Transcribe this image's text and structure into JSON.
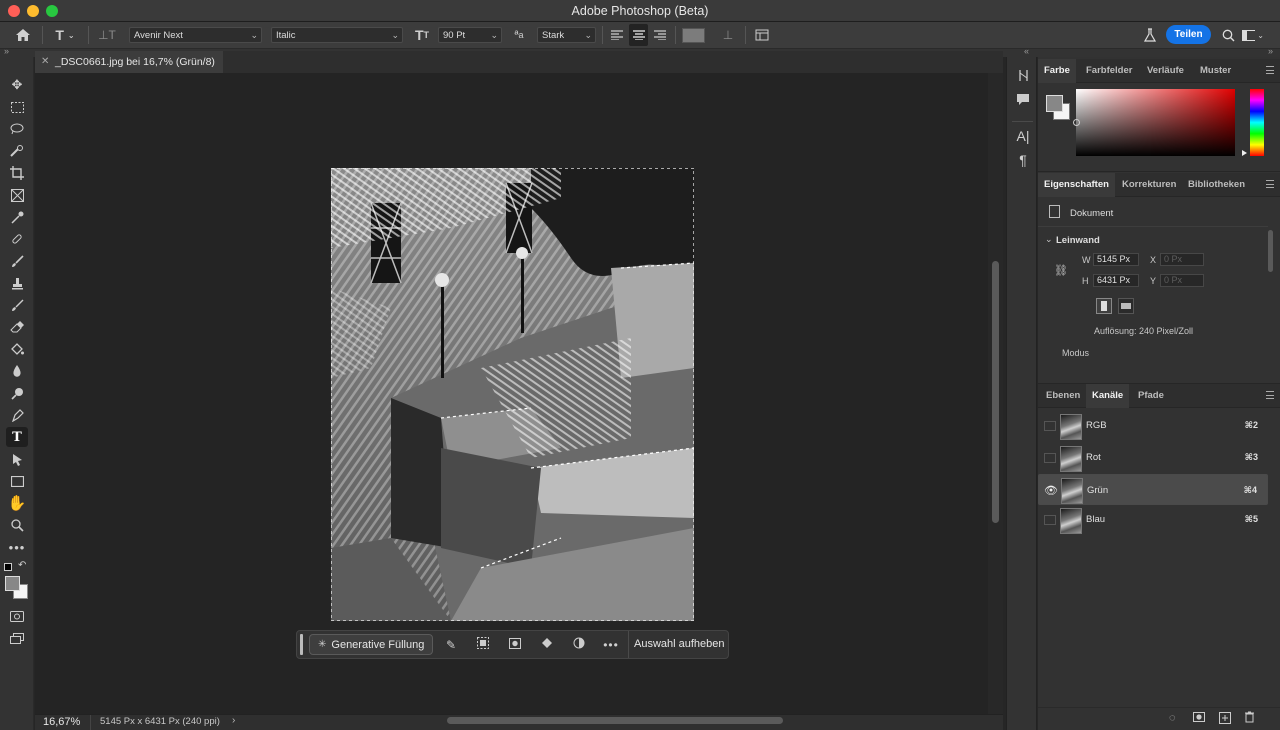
{
  "window": {
    "title": "Adobe Photoshop (Beta)"
  },
  "options_bar": {
    "font_family": "Avenir Next",
    "font_style": "Italic",
    "font_size": "90 Pt",
    "antialias": "Stark",
    "share_label": "Teilen"
  },
  "document": {
    "tab_title": "_DSC0661.jpg bei 16,7% (Grün/8)",
    "zoom": "16,67%",
    "info": "5145 Px x 6431 Px (240 ppi)"
  },
  "context_bar": {
    "generative_fill_label": "Generative Füllung",
    "deselect_label": "Auswahl aufheben"
  },
  "color_panel": {
    "tabs": [
      "Farbe",
      "Farbfelder",
      "Verläufe",
      "Muster"
    ],
    "hue_color": "#e00000"
  },
  "properties_panel": {
    "tabs": [
      "Eigenschaften",
      "Korrekturen",
      "Bibliotheken"
    ],
    "doc_label": "Dokument",
    "section": "Leinwand",
    "w_label": "W",
    "w_value": "5145 Px",
    "h_label": "H",
    "h_value": "6431 Px",
    "x_label": "X",
    "x_value": "0 Px",
    "y_label": "Y",
    "y_value": "0 Px",
    "resolution": "Auflösung: 240 Pixel/Zoll",
    "mode_label": "Modus"
  },
  "channels_panel": {
    "tabs": [
      "Ebenen",
      "Kanäle",
      "Pfade"
    ],
    "channels": [
      {
        "name": "RGB",
        "shortcut": "⌘2"
      },
      {
        "name": "Rot",
        "shortcut": "⌘3"
      },
      {
        "name": "Grün",
        "shortcut": "⌘4"
      },
      {
        "name": "Blau",
        "shortcut": "⌘5"
      }
    ]
  }
}
